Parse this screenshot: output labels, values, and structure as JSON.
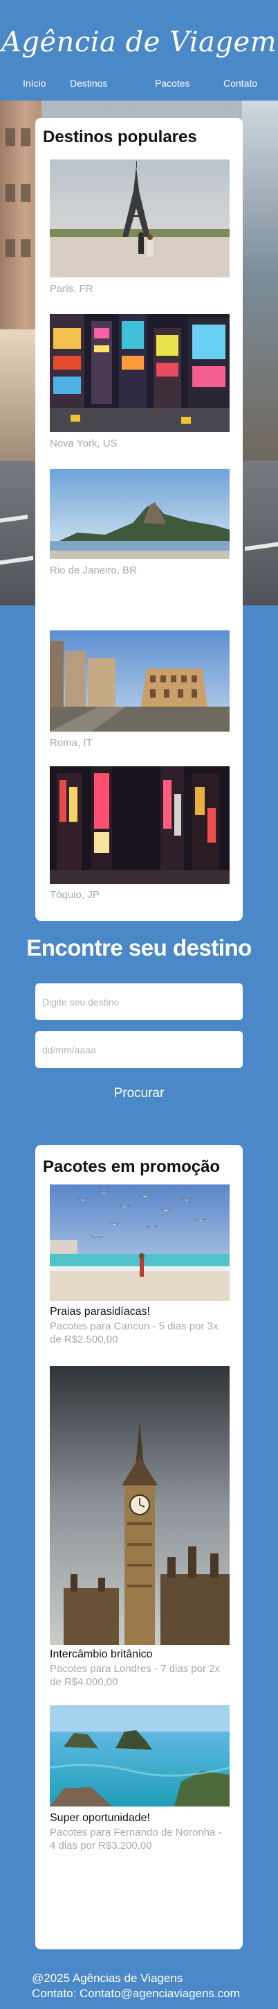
{
  "header": {
    "brand": "Agência de Viagem",
    "nav": [
      "Início",
      "Destinos",
      "Pacotes",
      "Contato"
    ]
  },
  "popular": {
    "title": "Destinos populares",
    "items": [
      {
        "caption": "Paris, FR"
      },
      {
        "caption": "Nova York, US"
      },
      {
        "caption": "Rio de Janeiro, BR"
      },
      {
        "caption": "Roma, IT"
      },
      {
        "caption": "Tóquio, JP"
      }
    ]
  },
  "search": {
    "title": "Encontre seu destino",
    "destination_placeholder": "Digite seu destino",
    "date_placeholder": "dd/mm/aaaa",
    "button": "Procurar"
  },
  "packages": {
    "title": "Pacotes em promoção",
    "items": [
      {
        "name": "Praias parasidíacas!",
        "desc": "Pacotes para Cancun - 5 dias por 3x de R$2.500,00"
      },
      {
        "name": "Intercâmbio britânico",
        "desc": "Pacotes para Londres - 7 dias por 2x de R$4.000,00"
      },
      {
        "name": "Super oportunidade!",
        "desc": "Pacotes para Fernando de Noronha - 4 dias por R$3.200,00"
      }
    ]
  },
  "footer": {
    "copyright": "@2025 Agências de Viagens",
    "contact": "Contato: Contato@agenciaviagens.com"
  },
  "colors": {
    "background": "#4b88c7",
    "card": "#ffffff",
    "caption": "#a9a9a9"
  }
}
